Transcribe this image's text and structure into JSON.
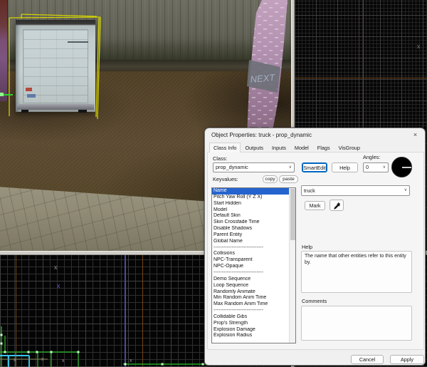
{
  "window": {
    "title": "Object Properties: truck - prop_dynamic"
  },
  "icons": {
    "close": "×",
    "chevron": "∨",
    "x_marker": "x"
  },
  "tabs": [
    {
      "label": "Class Info",
      "active": true
    },
    {
      "label": "Outputs",
      "active": false
    },
    {
      "label": "Inputs",
      "active": false
    },
    {
      "label": "Model",
      "active": false
    },
    {
      "label": "Flags",
      "active": false
    },
    {
      "label": "VisGroup",
      "active": false
    }
  ],
  "class_info": {
    "label": "Class:",
    "value": "prop_dynamic",
    "smartedit_label": "SmartEdit",
    "help_label": "Help",
    "angles_label": "Angles:",
    "angles_value": "0"
  },
  "keyvalues": {
    "label": "Keyvalues:",
    "copy_label": "copy",
    "paste_label": "paste",
    "selected": "Name",
    "items": [
      "Name",
      "Pitch Yaw Roll (Y Z X)",
      "Start Hidden",
      "Model",
      "Default Skin",
      "Skin Crossfade Time",
      "Disable Shadows",
      "Parent Entity",
      "Global Name",
      "------------------------------",
      "Collisions",
      "NPC-Transparent",
      "NPC-Opaque",
      "------------------------------",
      "Demo Sequence",
      "Loop Sequence",
      "Randomly Animate",
      "Min Random Anim Time",
      "Max Random Anim Time",
      "------------------------------",
      "Collidable Gibs",
      "Prop's Strength",
      "Explosion Damage",
      "Explosion Radius"
    ]
  },
  "entity": {
    "name_value": "truck",
    "mark_label": "Mark",
    "help_heading": "Help",
    "help_text": "The name that other entities refer to this entity by.",
    "comments_label": "Comments",
    "comments_value": ""
  },
  "footer": {
    "cancel_label": "Cancel",
    "apply_label": "Apply"
  },
  "scene": {
    "graffiti_text": "NEXT"
  },
  "colors": {
    "accent_blue": "#0067c0",
    "selection_row_blue": "#2563cf",
    "selection_wireframe_yellow": "#d8d800",
    "axis_orange": "#6f4516",
    "axis_blue": "#4b4b9e",
    "grid_minor": "#2f2f2f"
  }
}
